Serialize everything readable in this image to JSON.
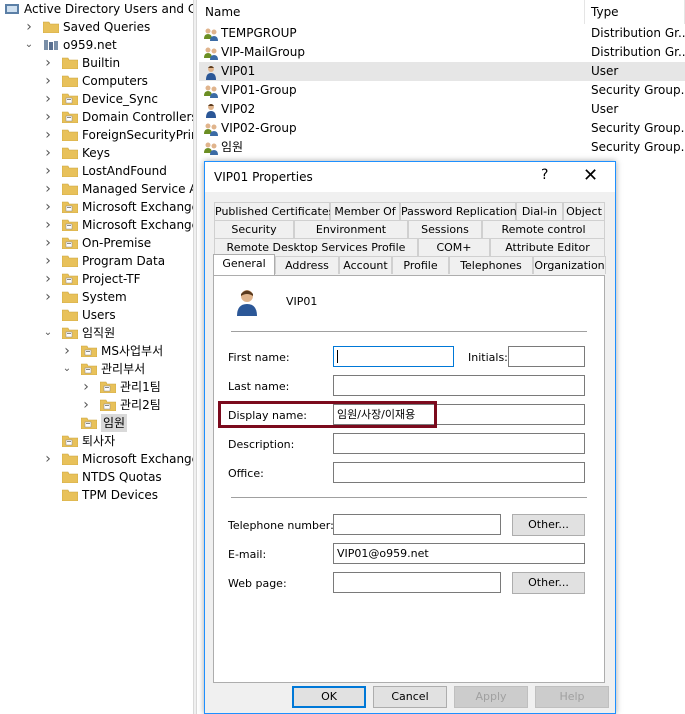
{
  "tree": {
    "items": [
      {
        "label": "Active Directory Users and Com",
        "depth": 0,
        "chev": "",
        "icon": "ad-root"
      },
      {
        "label": "Saved Queries",
        "depth": 1,
        "chev": "right",
        "icon": "folder"
      },
      {
        "label": "o959.net",
        "depth": 1,
        "chev": "down",
        "icon": "domain"
      },
      {
        "label": "Builtin",
        "depth": 2,
        "chev": "right",
        "icon": "folder"
      },
      {
        "label": "Computers",
        "depth": 2,
        "chev": "right",
        "icon": "folder"
      },
      {
        "label": "Device_Sync",
        "depth": 2,
        "chev": "right",
        "icon": "ou"
      },
      {
        "label": "Domain Controllers",
        "depth": 2,
        "chev": "right",
        "icon": "ou"
      },
      {
        "label": "ForeignSecurityPrincipals",
        "depth": 2,
        "chev": "right",
        "icon": "folder"
      },
      {
        "label": "Keys",
        "depth": 2,
        "chev": "right",
        "icon": "folder"
      },
      {
        "label": "LostAndFound",
        "depth": 2,
        "chev": "right",
        "icon": "folder"
      },
      {
        "label": "Managed Service Accour",
        "depth": 2,
        "chev": "right",
        "icon": "folder"
      },
      {
        "label": "Microsoft Exchange Prot",
        "depth": 2,
        "chev": "right",
        "icon": "ou"
      },
      {
        "label": "Microsoft Exchange Secu",
        "depth": 2,
        "chev": "right",
        "icon": "ou"
      },
      {
        "label": "On-Premise",
        "depth": 2,
        "chev": "right",
        "icon": "ou"
      },
      {
        "label": "Program Data",
        "depth": 2,
        "chev": "right",
        "icon": "folder"
      },
      {
        "label": "Project-TF",
        "depth": 2,
        "chev": "right",
        "icon": "ou"
      },
      {
        "label": "System",
        "depth": 2,
        "chev": "right",
        "icon": "folder"
      },
      {
        "label": "Users",
        "depth": 2,
        "chev": "",
        "icon": "folder"
      },
      {
        "label": "임직원",
        "depth": 2,
        "chev": "down",
        "icon": "ou"
      },
      {
        "label": "MS사업부서",
        "depth": 3,
        "chev": "right",
        "icon": "ou"
      },
      {
        "label": "관리부서",
        "depth": 3,
        "chev": "down",
        "icon": "ou"
      },
      {
        "label": "관리1팀",
        "depth": 4,
        "chev": "right",
        "icon": "ou"
      },
      {
        "label": "관리2팀",
        "depth": 4,
        "chev": "right",
        "icon": "ou"
      },
      {
        "label": "임원",
        "depth": 3,
        "chev": "",
        "icon": "ou",
        "selected": true
      },
      {
        "label": "퇴사자",
        "depth": 2,
        "chev": "",
        "icon": "ou"
      },
      {
        "label": "Microsoft Exchange Syste",
        "depth": 2,
        "chev": "right",
        "icon": "folder"
      },
      {
        "label": "NTDS Quotas",
        "depth": 2,
        "chev": "",
        "icon": "folder"
      },
      {
        "label": "TPM Devices",
        "depth": 2,
        "chev": "",
        "icon": "folder"
      }
    ]
  },
  "list": {
    "columns": {
      "name": "Name",
      "type": "Type"
    },
    "rows": [
      {
        "name": "TEMPGROUP",
        "type": "Distribution Gr...",
        "icon": "group-icon"
      },
      {
        "name": "VIP-MailGroup",
        "type": "Distribution Gr...",
        "icon": "group-icon"
      },
      {
        "name": "VIP01",
        "type": "User",
        "icon": "user-icon",
        "selected": true
      },
      {
        "name": "VIP01-Group",
        "type": "Security Group...",
        "icon": "group-icon"
      },
      {
        "name": "VIP02",
        "type": "User",
        "icon": "user-icon"
      },
      {
        "name": "VIP02-Group",
        "type": "Security Group...",
        "icon": "group-icon"
      },
      {
        "name": "임원",
        "type": "Security Group...",
        "icon": "group-icon"
      }
    ]
  },
  "dialog": {
    "title": "VIP01 Properties",
    "help": "?",
    "close": "✕",
    "tabs_row1": [
      "Published Certificates",
      "Member Of",
      "Password Replication",
      "Dial-in",
      "Object"
    ],
    "tabs_row2": [
      "Security",
      "Environment",
      "Sessions",
      "Remote control"
    ],
    "tabs_row3": [
      "Remote Desktop Services Profile",
      "COM+",
      "Attribute Editor"
    ],
    "tabs_row4": [
      "General",
      "Address",
      "Account",
      "Profile",
      "Telephones",
      "Organization"
    ],
    "active_tab": "General",
    "general": {
      "user_name": "VIP01",
      "first_name_label": "First name:",
      "first_name": "",
      "initials_label": "Initials:",
      "initials": "",
      "last_name_label": "Last name:",
      "last_name": "",
      "display_name_label": "Display name:",
      "display_name": "임원/사장/이재용",
      "description_label": "Description:",
      "description": "",
      "office_label": "Office:",
      "office": "",
      "telephone_label": "Telephone number:",
      "telephone": "",
      "email_label": "E-mail:",
      "email": "VIP01@o959.net",
      "webpage_label": "Web page:",
      "webpage": "",
      "other_label": "Other..."
    },
    "buttons": {
      "ok": "OK",
      "cancel": "Cancel",
      "apply": "Apply",
      "help": "Help"
    },
    "highlight_color": "#7b0a1d"
  }
}
